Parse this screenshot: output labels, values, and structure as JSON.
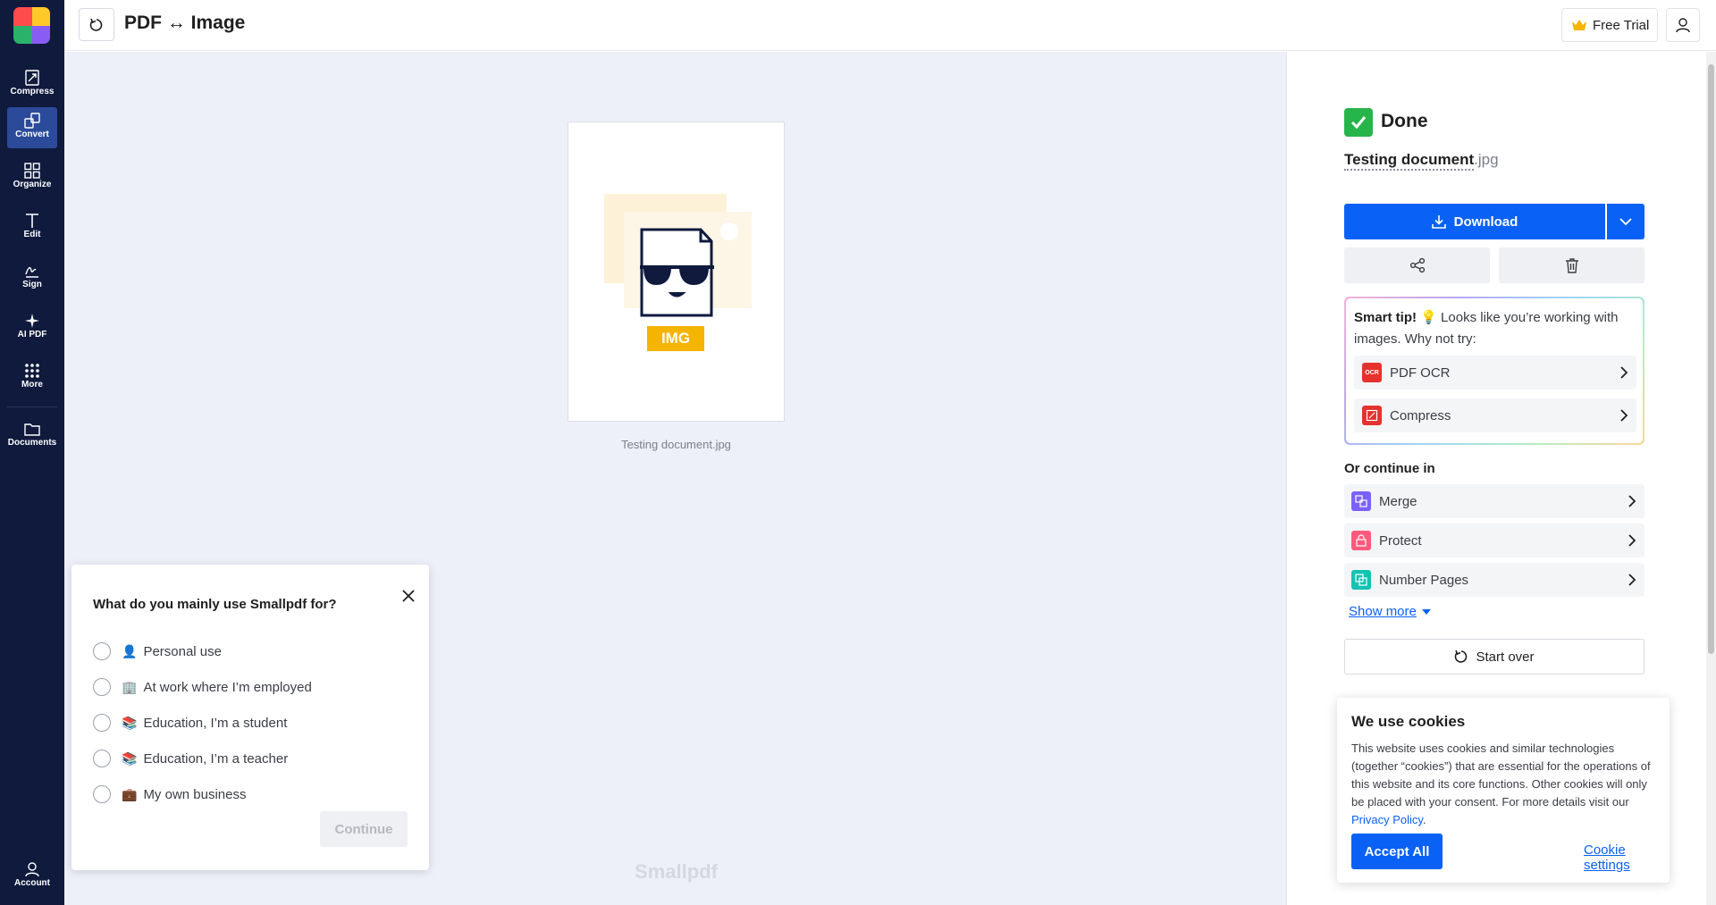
{
  "sidebar": {
    "items": [
      {
        "label": "Compress",
        "icon": "compress-icon"
      },
      {
        "label": "Convert",
        "icon": "convert-icon"
      },
      {
        "label": "Organize",
        "icon": "organize-icon"
      },
      {
        "label": "Edit",
        "icon": "edit-icon"
      },
      {
        "label": "Sign",
        "icon": "sign-icon"
      },
      {
        "label": "AI PDF",
        "icon": "sparkle-icon"
      },
      {
        "label": "More",
        "icon": "grid-icon"
      },
      {
        "label": "Documents",
        "icon": "folder-icon"
      },
      {
        "label": "Account",
        "icon": "user-icon"
      }
    ],
    "active": "Convert"
  },
  "header": {
    "title": "PDF ↔ Image",
    "trial_label": "Free Trial"
  },
  "preview": {
    "badge": "IMG",
    "file_label": "Testing document.jpg",
    "watermark": "Smallpdf"
  },
  "survey": {
    "title": "What do you mainly use Smallpdf for?",
    "options": [
      {
        "emoji": "👤",
        "label": "Personal use"
      },
      {
        "emoji": "🏢",
        "label": "At work where I’m employed"
      },
      {
        "emoji": "📚",
        "label": "Education, I’m a student"
      },
      {
        "emoji": "📚",
        "label": "Education, I’m a teacher"
      },
      {
        "emoji": "💼",
        "label": "My own business"
      }
    ],
    "continue_label": "Continue"
  },
  "result": {
    "status": "Done",
    "file_base": "Testing document",
    "file_ext": ".jpg",
    "download_label": "Download"
  },
  "smart_tip": {
    "heading": "Smart tip!",
    "bulb": "💡",
    "text": "Looks like you’re working with images. Why not try:",
    "tools": [
      {
        "label": "PDF OCR",
        "icon_text": "OCR",
        "color": "#e5322d"
      },
      {
        "label": "Compress",
        "icon_text": "",
        "color": "#e5322d"
      }
    ]
  },
  "continue_in": {
    "heading": "Or continue in",
    "tools": [
      {
        "label": "Merge",
        "color": "#7b61ff"
      },
      {
        "label": "Protect",
        "color": "#ff5a7d"
      },
      {
        "label": "Number Pages",
        "color": "#13c3b0"
      }
    ],
    "show_more": "Show more",
    "start_over": "Start over"
  },
  "cookie": {
    "title": "We use cookies",
    "text": "This website uses cookies and similar technologies (together “cookies”) that are essential for the operations of this website and its core functions. Other cookies will only be placed with your consent. For more details visit our ",
    "link": "Privacy Policy",
    "period": ".",
    "accept": "Accept All",
    "settings": "Cookie settings"
  },
  "colors": {
    "sidebar_bg": "#0f1a3d",
    "sidebar_active": "#2b4a99",
    "primary": "#0a61f5",
    "success": "#26b54a",
    "badge": "#f5b400"
  }
}
